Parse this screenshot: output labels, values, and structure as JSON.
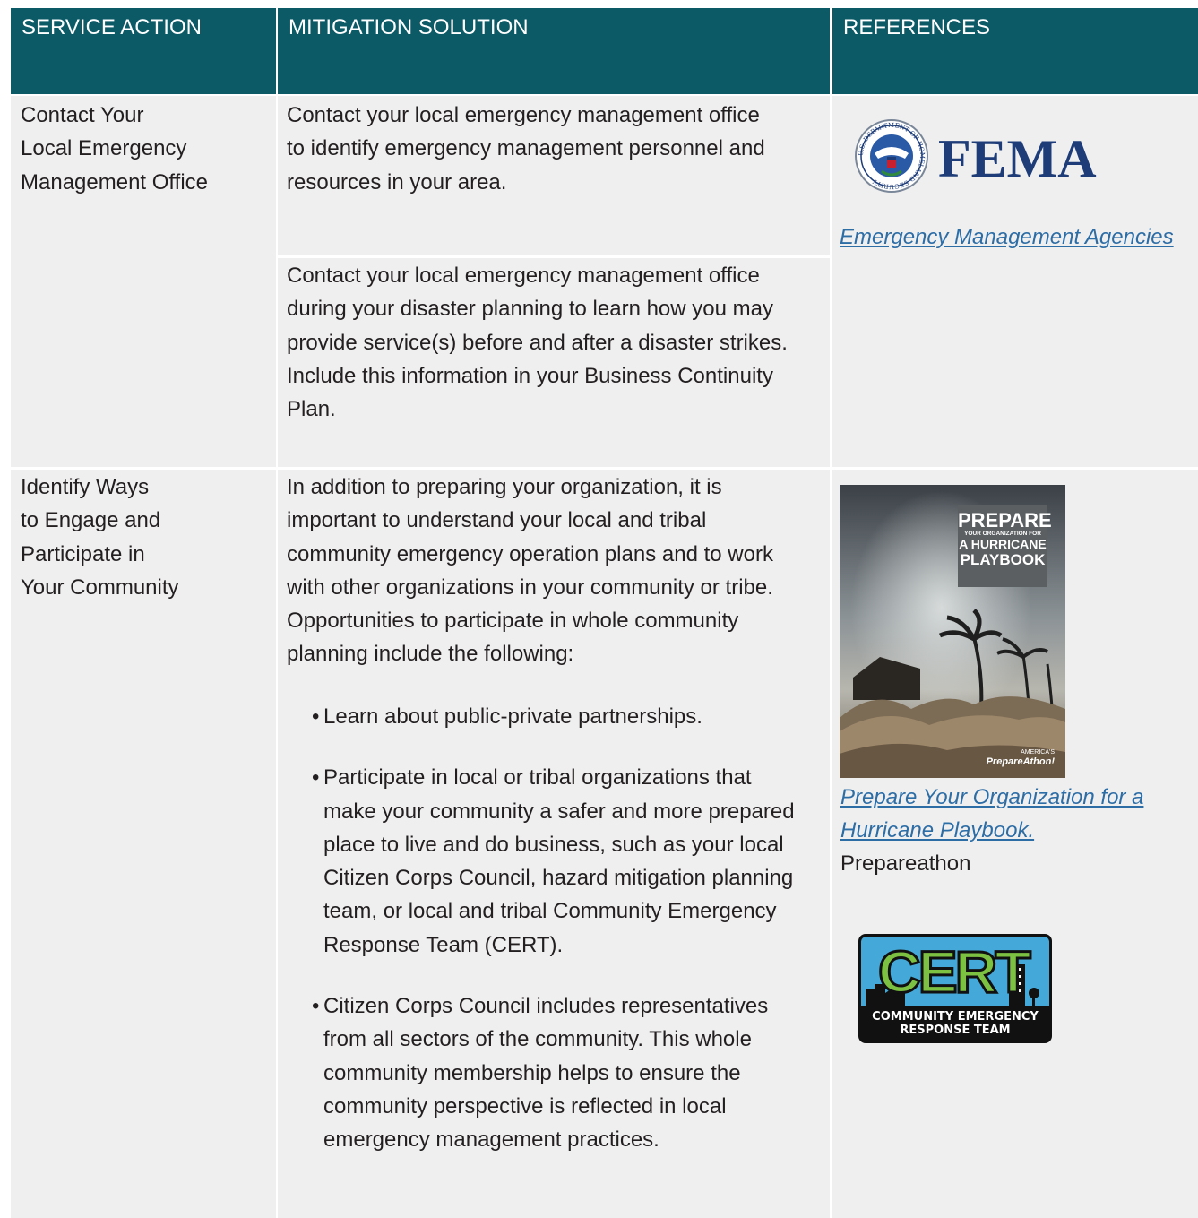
{
  "headers": {
    "service_action": "SERVICE ACTION",
    "mitigation_solution": "MITIGATION SOLUTION",
    "references": "REFERENCES"
  },
  "row1": {
    "service_action": [
      "Contact Your",
      "Local Emergency",
      "Management Office"
    ],
    "solution_a": [
      "Contact your local emergency management office",
      "to identify emergency management personnel and",
      "resources in your area."
    ],
    "solution_b": [
      "Contact your local emergency management office",
      "during your disaster planning to learn how you may",
      "provide service(s) before and after a disaster strikes.",
      "Include this information in your Business Continuity",
      "Plan."
    ],
    "fema_logo_text": "FEMA",
    "fema_seal_text": "U.S. DEPARTMENT OF HOMELAND SECURITY",
    "reference_link": "Emergency Management Agencies"
  },
  "row2": {
    "service_action": [
      "Identify Ways",
      "to Engage and",
      "Participate in",
      "Your Community"
    ],
    "intro": [
      "In addition to preparing your organization, it is",
      "important to understand your local and tribal",
      "community emergency operation plans and to work",
      "with other organizations in your community or tribe.",
      "Opportunities to participate in whole community",
      "planning include the following:"
    ],
    "bullets": [
      [
        "Learn about public-private partnerships."
      ],
      [
        "Participate in local or tribal organizations that",
        "make your community a safer and more prepared",
        "place to live and do business, such as your local",
        "Citizen Corps Council, hazard mitigation planning",
        "team, or local and tribal Community Emergency",
        "Response Team (CERT)."
      ],
      [
        "Citizen Corps Council includes representatives",
        "from all sectors of the community. This whole",
        "community membership helps to ensure the",
        "community perspective is reflected in local",
        "emergency management practices."
      ]
    ],
    "playbook_cover": {
      "title_line1": "PREPARE",
      "title_line2": "YOUR ORGANIZATION FOR",
      "title_line3": "A HURRICANE",
      "title_line4": "PLAYBOOK",
      "brand_top": "AMERICA'S",
      "brand": "PrepareAthon!"
    },
    "reference_link_lines": [
      "Prepare Your Organization for a ",
      "Hurricane Playbook."
    ],
    "reference_source": "Prepareathon",
    "cert_logo": {
      "letters": "CERT",
      "line1": "COMMUNITY EMERGENCY",
      "line2": "RESPONSE TEAM"
    }
  }
}
